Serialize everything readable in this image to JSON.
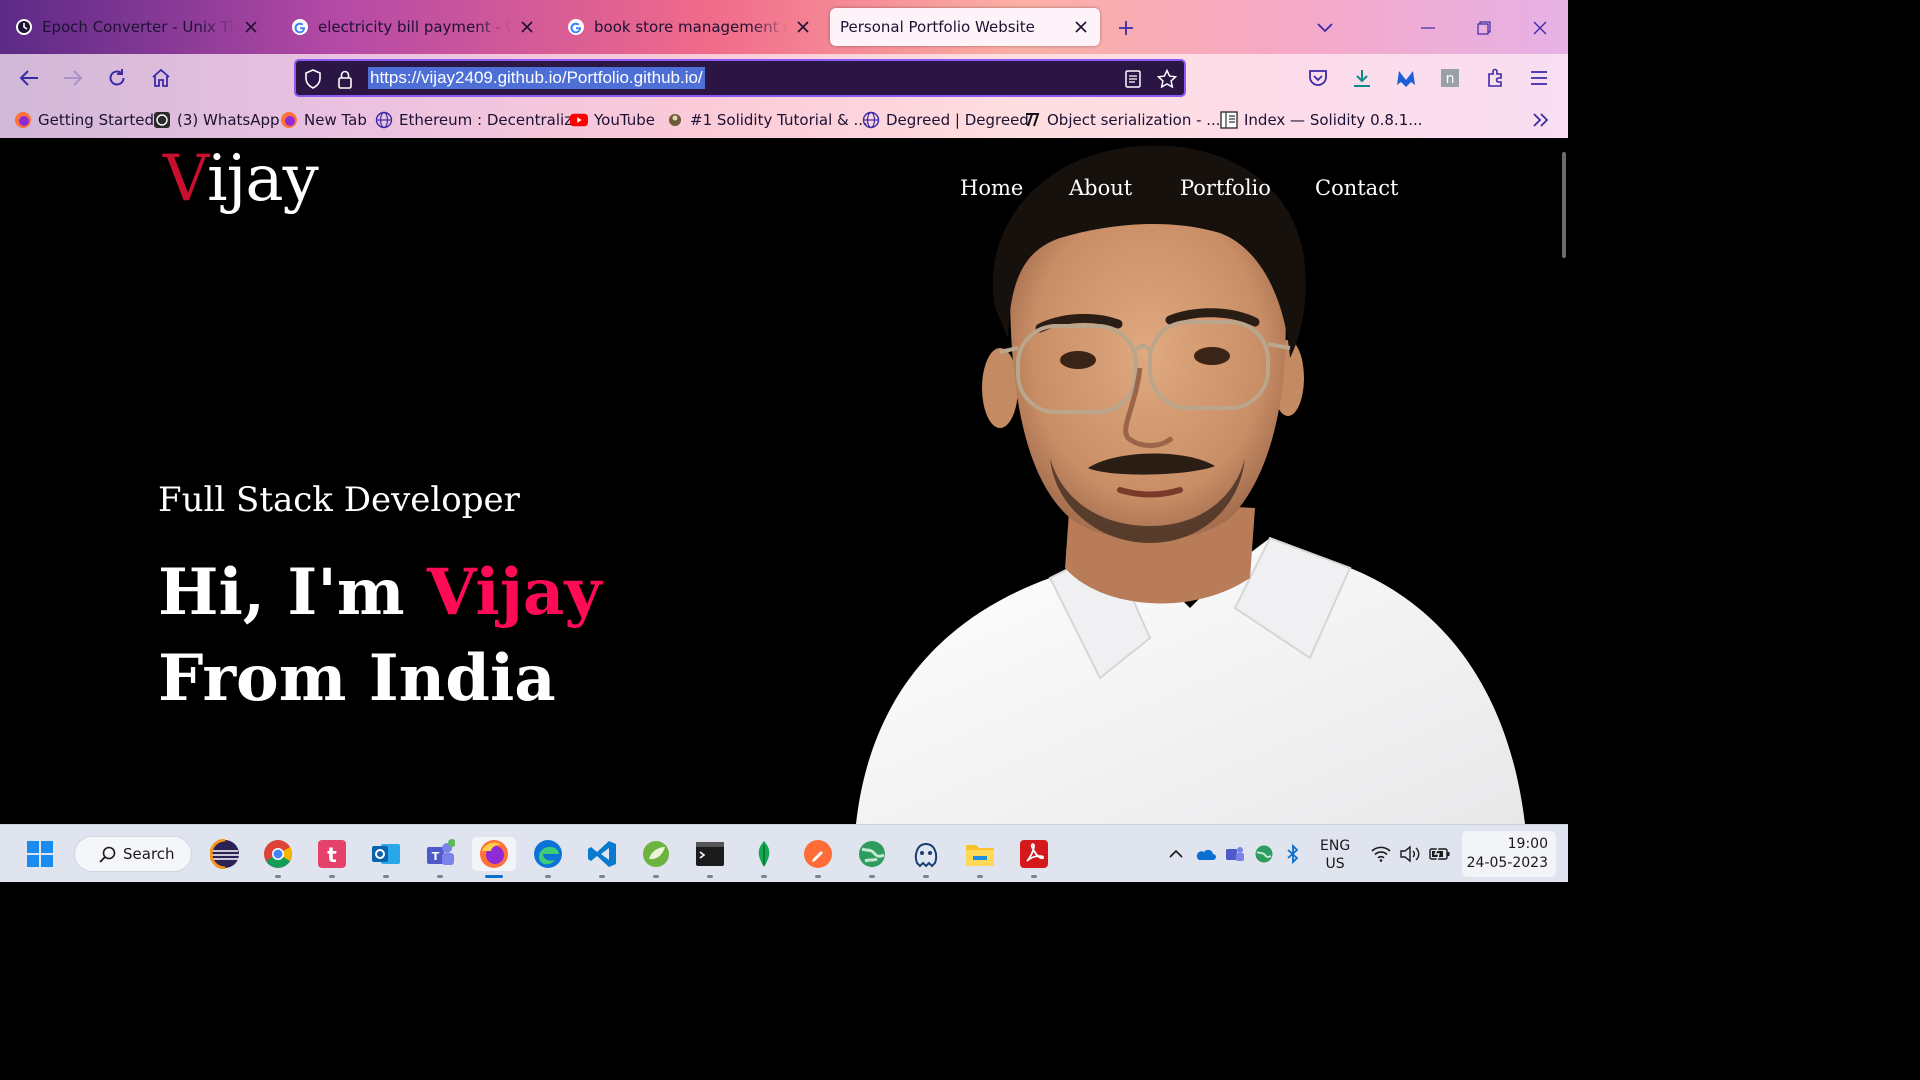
{
  "browser": {
    "tabs": [
      {
        "title": "Epoch Converter - Unix Timestamp Converter",
        "icon": "clock-icon",
        "active": false
      },
      {
        "title": "electricity bill payment - Google Search",
        "icon": "google-icon",
        "active": false
      },
      {
        "title": "book store management application - Google Search",
        "icon": "google-icon",
        "active": false
      },
      {
        "title": "Personal Portfolio Website",
        "icon": "none",
        "active": true
      }
    ],
    "url": "https://vijay2409.github.io/Portfolio.github.io/",
    "bookmarks": [
      {
        "label": "Getting Started",
        "icon": "firefox-icon"
      },
      {
        "label": "(3) WhatsApp",
        "icon": "whatsapp-icon"
      },
      {
        "label": "New Tab",
        "icon": "firefox-icon"
      },
      {
        "label": "Ethereum : Decentraliz...",
        "icon": "globe-icon"
      },
      {
        "label": "YouTube",
        "icon": "youtube-icon"
      },
      {
        "label": "#1 Solidity Tutorial & ...",
        "icon": "avatar-icon"
      },
      {
        "label": "Degreed | Degreed",
        "icon": "globe-icon"
      },
      {
        "label": "Object serialization - ...",
        "icon": "mdn-icon"
      },
      {
        "label": "Index — Solidity 0.8.1...",
        "icon": "doc-icon"
      }
    ]
  },
  "site": {
    "logo_first": "V",
    "logo_rest": "ijay",
    "nav": [
      "Home",
      "About",
      "Portfolio",
      "Contact"
    ],
    "subtitle": "Full Stack Developer",
    "greeting": "Hi, I'm ",
    "name": "Vijay",
    "line2": "From India",
    "accent_color": "#ff0b55",
    "logo_color": "#c8102e"
  },
  "taskbar": {
    "search_label": "Search",
    "language": "ENG",
    "region": "US",
    "time": "19:00",
    "date": "24-05-2023"
  }
}
